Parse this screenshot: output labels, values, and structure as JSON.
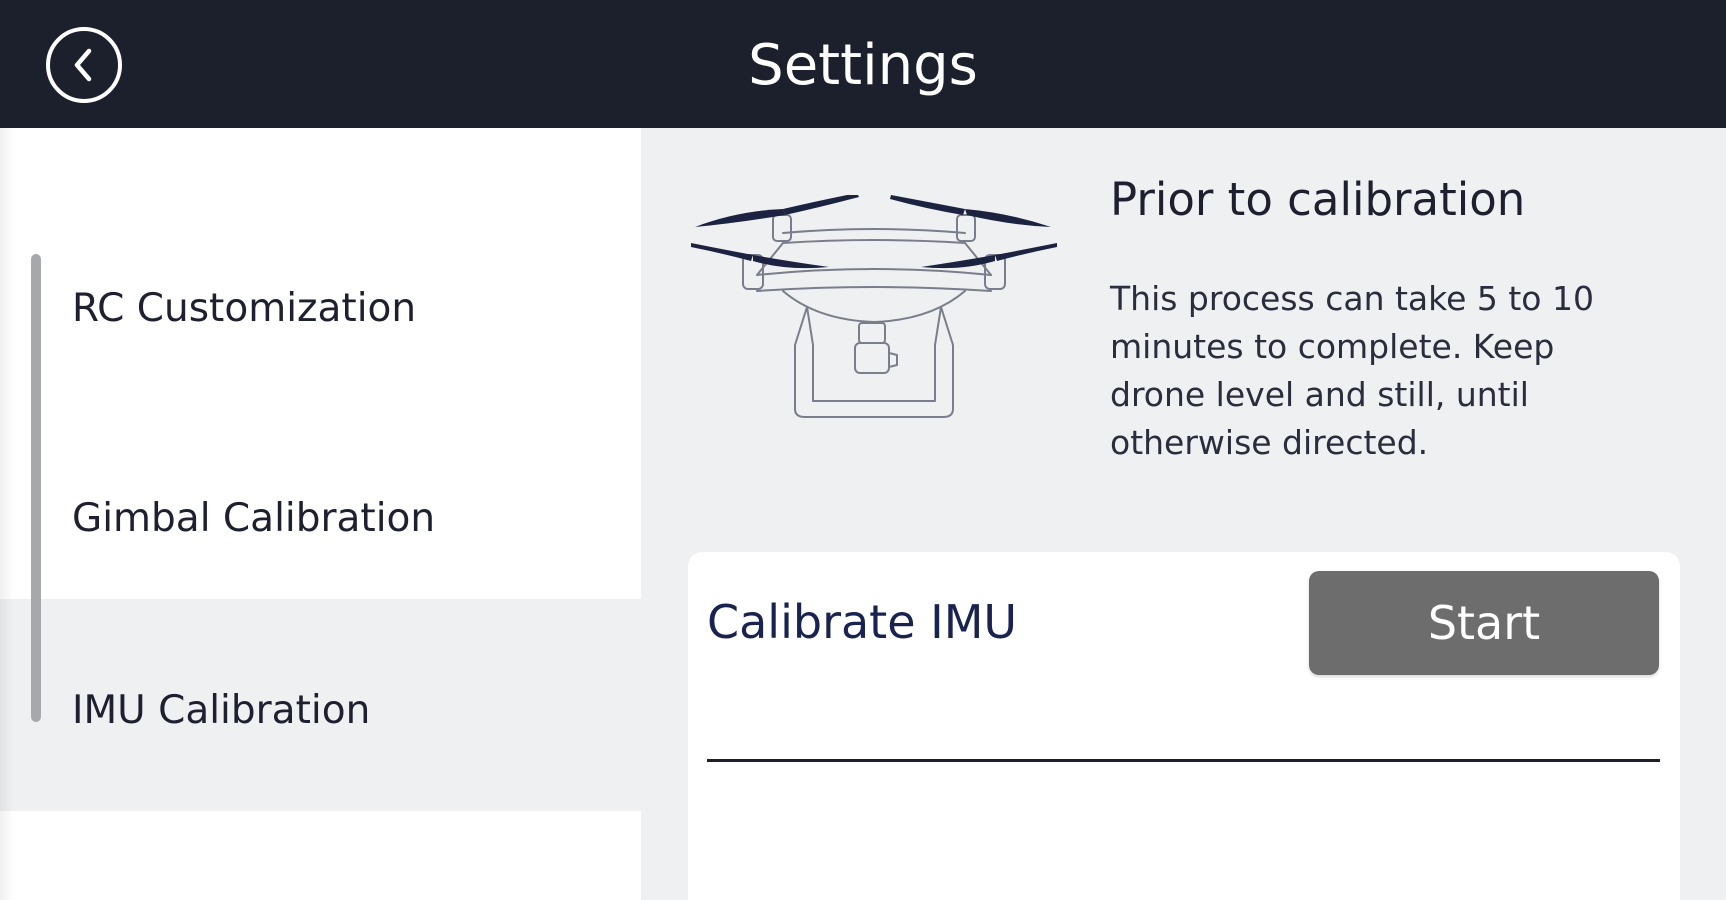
{
  "header": {
    "title": "Settings",
    "back_icon": "chevron-left-icon"
  },
  "sidebar": {
    "items": [
      {
        "label": "RC Customization",
        "active": false
      },
      {
        "label": "Gimbal Calibration",
        "active": false
      },
      {
        "label": "IMU Calibration",
        "active": true
      }
    ]
  },
  "main": {
    "illustration_icon": "drone-icon",
    "info_title": "Prior to calibration",
    "info_text": "This process can take 5 to 10 minutes to complete. Keep drone level and still, until otherwise directed.",
    "card": {
      "title": "Calibrate IMU",
      "button_label": "Start"
    }
  },
  "colors": {
    "header_bg": "#1c1f2c",
    "sidebar_bg": "#ffffff",
    "content_bg": "#eef0f2",
    "accent_navy": "#1a2350",
    "button_gray": "#6d6d6d"
  }
}
